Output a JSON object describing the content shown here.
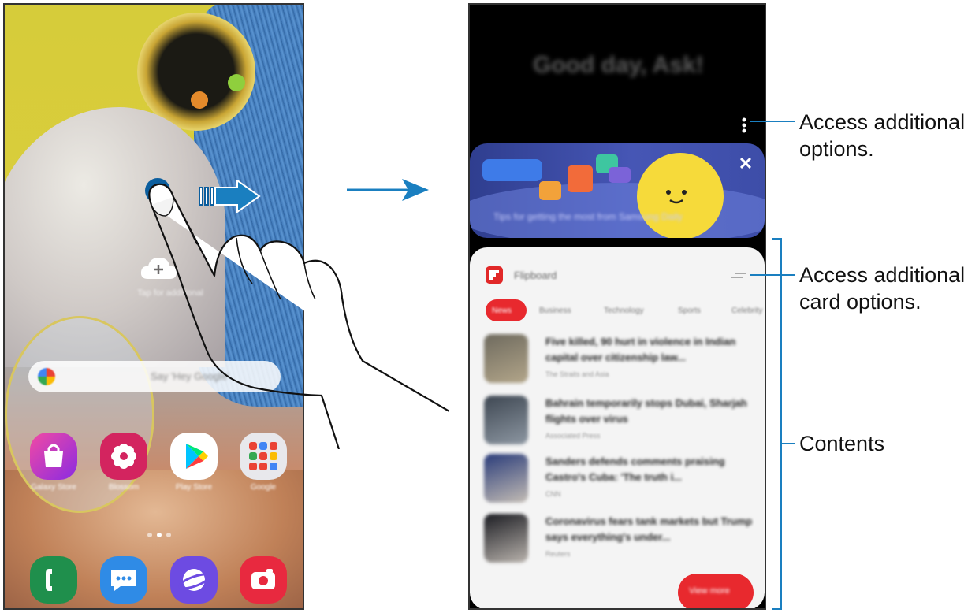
{
  "left_phone": {
    "wallpaper_hint_text": "Tap for additional",
    "search_hint": "Say 'Hey Google'",
    "apps": [
      {
        "name": "Galaxy Store",
        "icon": "shopping-bag-icon"
      },
      {
        "name": "Blossom",
        "icon": "flower-icon"
      },
      {
        "name": "Play Store",
        "icon": "play-store-icon"
      },
      {
        "name": "Google",
        "icon": "folder-icon"
      }
    ],
    "dock": [
      {
        "name": "Phone",
        "icon": "phone-icon"
      },
      {
        "name": "Messages",
        "icon": "messages-icon"
      },
      {
        "name": "Internet",
        "icon": "internet-icon"
      },
      {
        "name": "Camera",
        "icon": "camera-icon"
      }
    ],
    "page_indicator": {
      "count": 3,
      "active": 2
    }
  },
  "right_phone": {
    "greeting": "Good day, Ask!",
    "banner": {
      "text": "Tips for getting the most from Samsung Daily",
      "close_icon": "close-icon"
    },
    "card": {
      "source": "Flipboard",
      "tabs": [
        "News",
        "Business",
        "Technology",
        "Sports",
        "Celebrity"
      ],
      "articles": [
        {
          "headline": "Five killed, 90 hurt in violence in Indian capital over citizenship law...",
          "source": "The Straits and Asia"
        },
        {
          "headline": "Bahrain temporarily stops Dubai, Sharjah flights over virus",
          "source": "Associated Press"
        },
        {
          "headline": "Sanders defends comments praising Castro's Cuba: 'The truth i...",
          "source": "CNN"
        },
        {
          "headline": "Coronavirus fears tank markets but Trump says everything's under...",
          "source": "Reuters"
        }
      ],
      "view_more": "View more"
    }
  },
  "callouts": {
    "more_options": [
      "Access additional",
      "options."
    ],
    "card_options": [
      "Access additional",
      "card options."
    ],
    "contents": "Contents"
  },
  "colors": {
    "accent": "#1a7fc0",
    "card_red": "#e8292e"
  }
}
